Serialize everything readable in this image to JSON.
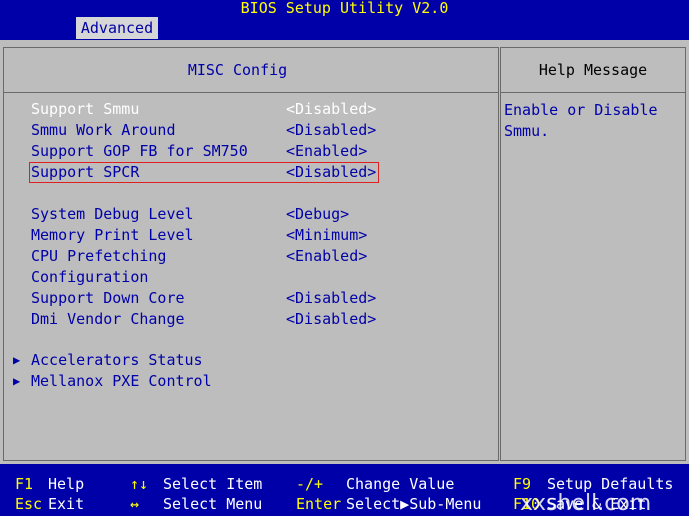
{
  "window": {
    "title": "BIOS Setup Utility V2.0",
    "tab": "Advanced"
  },
  "main": {
    "section_title": "MISC Config",
    "items": [
      {
        "label": "Support Smmu",
        "value": "<Disabled>"
      },
      {
        "label": "Smmu Work Around",
        "value": "<Disabled>"
      },
      {
        "label": "Support GOP FB for SM750",
        "value": "<Enabled>"
      },
      {
        "label": "Support SPCR",
        "value": "<Disabled>"
      },
      {
        "label": "System Debug Level",
        "value": "<Debug>"
      },
      {
        "label": "Memory Print Level",
        "value": "<Minimum>"
      },
      {
        "label": "CPU Prefetching",
        "value": "<Enabled>"
      },
      {
        "label": "Configuration",
        "value": ""
      },
      {
        "label": "Support Down Core",
        "value": "<Disabled>"
      },
      {
        "label": "Dmi Vendor Change",
        "value": "<Disabled>"
      }
    ],
    "submenus": [
      {
        "label": "Accelerators Status"
      },
      {
        "label": "Mellanox PXE Control"
      }
    ]
  },
  "help": {
    "title": "Help Message",
    "text": "Enable or Disable\nSmmu."
  },
  "footer": {
    "keys": [
      {
        "key": "F1",
        "desc": "Help"
      },
      {
        "key": "Esc",
        "desc": "Exit"
      },
      {
        "key": "↑↓",
        "desc": "Select Item"
      },
      {
        "key": "↔",
        "desc": "Select Menu"
      },
      {
        "key": "-/+",
        "desc": "Change Value"
      },
      {
        "key": "Enter",
        "desc": "Select▶Sub-Menu"
      },
      {
        "key": "F9",
        "desc": "Setup Defaults"
      },
      {
        "key": "F10",
        "desc": "Save & Exit"
      }
    ]
  },
  "watermark": "xxshell.com",
  "colors": {
    "background": "#0000a8",
    "panel": "#bdbdbd",
    "highlight_border": "#e02020",
    "title_text": "#ffff00"
  }
}
